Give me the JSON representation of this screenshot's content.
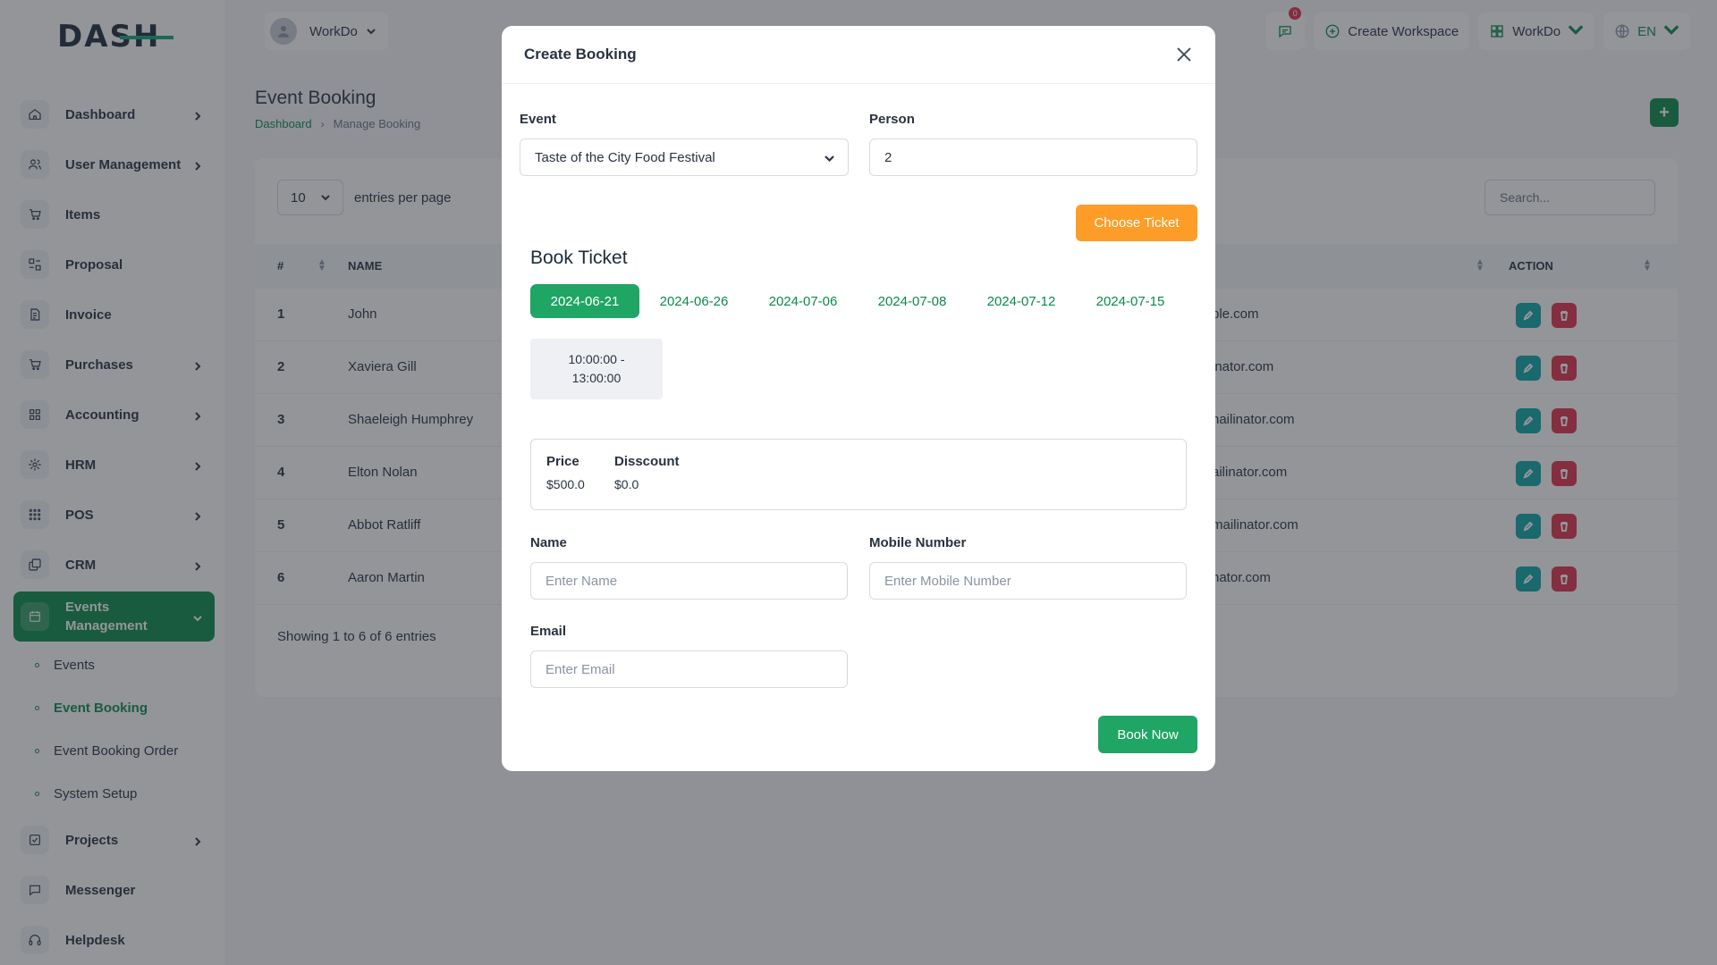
{
  "app": {
    "logo": "DASH"
  },
  "sidebar": {
    "items": [
      {
        "label": "Dashboard",
        "icon": "home-icon",
        "chevron": true
      },
      {
        "label": "User Management",
        "icon": "users-icon",
        "chevron": true
      },
      {
        "label": "Items",
        "icon": "cart-icon",
        "chevron": false
      },
      {
        "label": "Proposal",
        "icon": "proposal-icon",
        "chevron": false
      },
      {
        "label": "Invoice",
        "icon": "file-invoice-icon",
        "chevron": false
      },
      {
        "label": "Purchases",
        "icon": "shopping-cart-icon",
        "chevron": true
      },
      {
        "label": "Accounting",
        "icon": "layout-grid-icon",
        "chevron": true
      },
      {
        "label": "HRM",
        "icon": "hrm-icon",
        "chevron": true
      },
      {
        "label": "POS",
        "icon": "grid-dots-icon",
        "chevron": true
      },
      {
        "label": "CRM",
        "icon": "layers-icon",
        "chevron": true
      },
      {
        "label": "Events Management",
        "icon": "calendar-icon",
        "chevron": true,
        "active": true
      }
    ],
    "events_sub": [
      {
        "label": "Events"
      },
      {
        "label": "Event Booking",
        "active": true
      },
      {
        "label": "Event Booking Order"
      },
      {
        "label": "System Setup"
      }
    ],
    "items_after": [
      {
        "label": "Projects",
        "icon": "checklist-icon",
        "chevron": true
      },
      {
        "label": "Messenger",
        "icon": "message-icon",
        "chevron": false
      },
      {
        "label": "Helpdesk",
        "icon": "headset-icon",
        "chevron": false
      }
    ]
  },
  "header": {
    "workspace_user": "WorkDo",
    "messages_count": "0",
    "create_workspace": "Create Workspace",
    "workspace": "WorkDo",
    "language": "EN"
  },
  "page": {
    "title": "Event Booking",
    "breadcrumb": [
      "Dashboard",
      "Manage Booking"
    ]
  },
  "table": {
    "entries_value": "10",
    "entries_label": "entries per page",
    "search_placeholder": "Search...",
    "columns": [
      "#",
      "NAME",
      "ACTION"
    ],
    "rows": [
      {
        "num": "1",
        "name": "John",
        "email": "ple.com"
      },
      {
        "num": "2",
        "name": "Xaviera Gill",
        "email": "inator.com"
      },
      {
        "num": "3",
        "name": "Shaeleigh Humphrey",
        "email": "nailinator.com"
      },
      {
        "num": "4",
        "name": "Elton Nolan",
        "email": "ailinator.com"
      },
      {
        "num": "5",
        "name": "Abbot Ratliff",
        "email": "mailinator.com"
      },
      {
        "num": "6",
        "name": "Aaron Martin",
        "email": "nator.com"
      }
    ],
    "showing": "Showing 1 to 6 of 6 entries"
  },
  "modal": {
    "title": "Create Booking",
    "event_label": "Event",
    "event_value": "Taste of the City Food Festival",
    "person_label": "Person",
    "person_value": "2",
    "choose_ticket": "Choose Ticket",
    "book_ticket_title": "Book Ticket",
    "dates": [
      "2024-06-21",
      "2024-06-26",
      "2024-07-06",
      "2024-07-08",
      "2024-07-12",
      "2024-07-15"
    ],
    "active_date": "2024-06-21",
    "slot": "10:00:00 - 13:00:00",
    "price_label": "Price",
    "price_value": "$500.0",
    "discount_label": "Disscount",
    "discount_value": "$0.0",
    "name_label": "Name",
    "name_placeholder": "Enter Name",
    "mobile_label": "Mobile Number",
    "mobile_placeholder": "Enter Mobile Number",
    "email_label": "Email",
    "email_placeholder": "Enter Email",
    "book_now": "Book Now"
  },
  "colors": {
    "primary": "#0b8a4a",
    "success": "#1fa564",
    "warning": "#fd9d27",
    "danger": "#e0314b",
    "info": "#0aa6a6"
  }
}
